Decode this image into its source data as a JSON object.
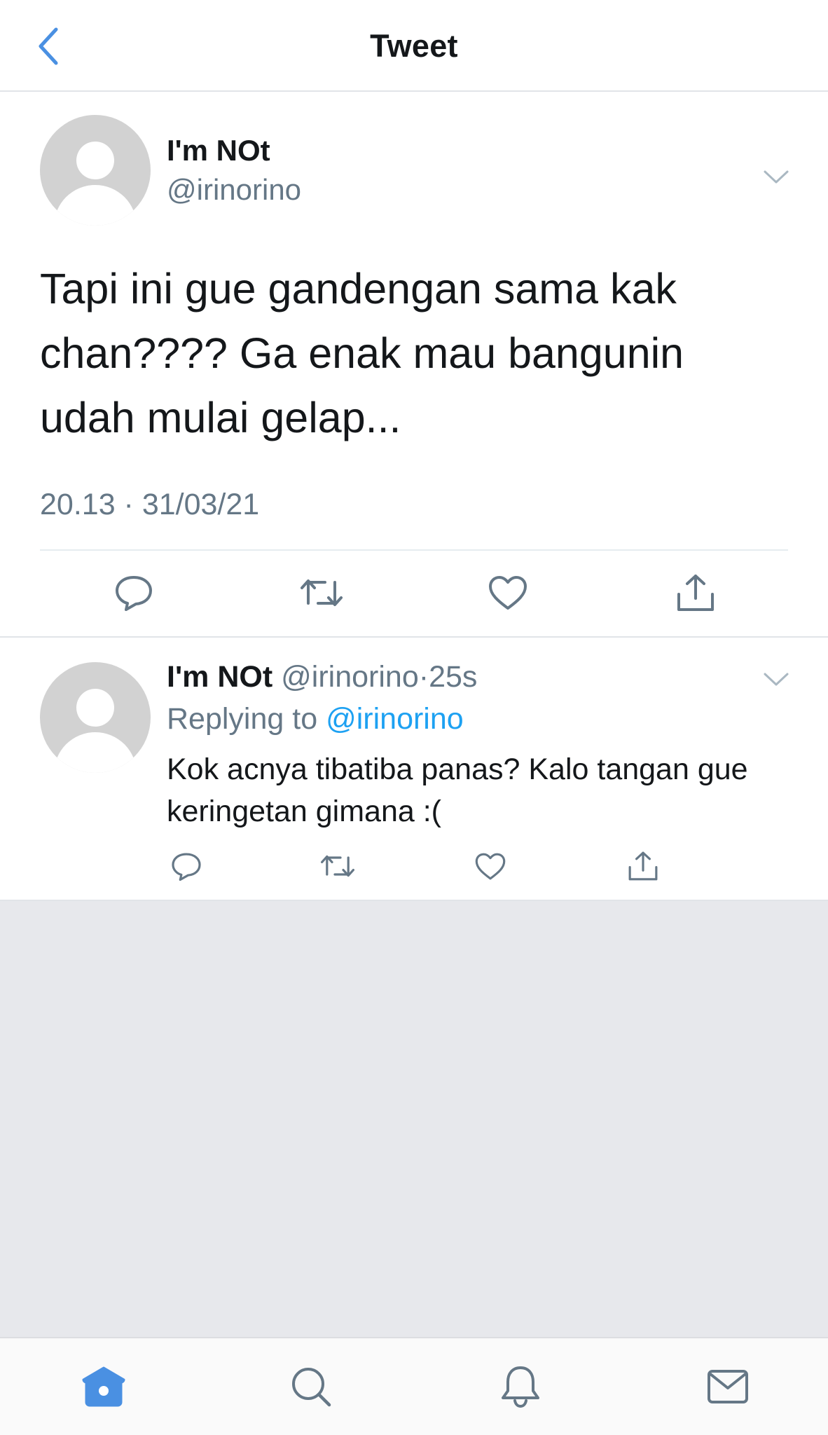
{
  "header": {
    "title": "Tweet",
    "back_icon": "chevron-left-icon"
  },
  "tweet": {
    "display_name": "I'm NOt",
    "handle": "@irinorino",
    "text": "Tapi ini gue gandengan sama kak chan???? Ga enak mau bangunin udah mulai gelap...",
    "timestamp": "20.13 · 31/03/21",
    "actions": [
      "reply-icon",
      "retweet-icon",
      "like-icon",
      "share-icon"
    ]
  },
  "reply": {
    "display_name": "I'm NOt",
    "handle": "@irinorino",
    "separator": "·",
    "age": "25s",
    "replying_prefix": "Replying to ",
    "replying_handle": "@irinorino",
    "text": "Kok acnya tibatiba panas? Kalo tangan gue keringetan gimana :(",
    "actions": [
      "reply-icon",
      "retweet-icon",
      "like-icon",
      "share-icon"
    ]
  },
  "tabbar": {
    "items": [
      "home-icon",
      "search-icon",
      "notifications-icon",
      "messages-icon"
    ],
    "active": "home-icon"
  },
  "colors": {
    "accent": "#1da1f2",
    "tab_active": "#4a90e2",
    "secondary_text": "#657786",
    "icon_gray": "#657786",
    "background_gray": "#e7e8ec"
  }
}
